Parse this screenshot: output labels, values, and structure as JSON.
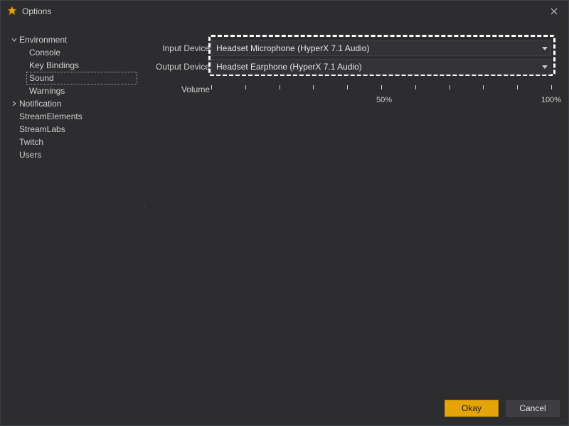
{
  "window": {
    "title": "Options"
  },
  "tree": {
    "environment": {
      "label": "Environment",
      "children": {
        "console": "Console",
        "key_bindings": "Key Bindings",
        "sound": "Sound",
        "warnings": "Warnings"
      }
    },
    "notification": {
      "label": "Notification"
    },
    "stream_elements": "StreamElements",
    "stream_labs": "StreamLabs",
    "twitch": "Twitch",
    "users": "Users"
  },
  "panel": {
    "input_label": "Input Device",
    "input_value": "Headset Microphone (HyperX 7.1 Audio)",
    "output_label": "Output Device",
    "output_value": "Headset Earphone (HyperX 7.1 Audio)",
    "volume_label": "Volume",
    "volume_ticks": {
      "mid": "50%",
      "max": "100%"
    }
  },
  "buttons": {
    "ok": "Okay",
    "cancel": "Cancel"
  }
}
